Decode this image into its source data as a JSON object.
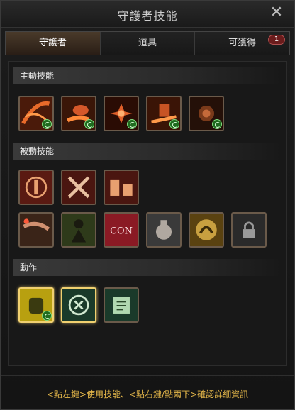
{
  "window": {
    "title": "守護者技能"
  },
  "tabs": [
    {
      "label": "守護者",
      "active": true
    },
    {
      "label": "道具"
    },
    {
      "label": "可獲得",
      "badge": "1"
    }
  ],
  "sections": {
    "active": {
      "label": "主動技能"
    },
    "passive": {
      "label": "被動技能"
    },
    "action": {
      "label": "動作"
    }
  },
  "footer": {
    "hint": "<點左鍵>使用技能、<點右鍵/點兩下>確認詳細資訊"
  },
  "icons": {
    "active_skills": [
      "fire-slash-icon",
      "flame-arm-icon",
      "fire-burst-icon",
      "fire-blade-icon",
      "fire-orb-icon"
    ],
    "passive_skills_row1": [
      "guardian-emblem-icon",
      "crossed-axes-icon",
      "gauntlets-icon"
    ],
    "passive_skills_row2": [
      "fire-wind-icon",
      "shadow-figure-icon",
      "con-stat-icon",
      "potion-bag-icon",
      "gold-claw-icon",
      "locked-slot-icon"
    ],
    "actions": [
      "fist-action-icon",
      "crosshair-action-icon",
      "scroll-action-icon"
    ]
  }
}
